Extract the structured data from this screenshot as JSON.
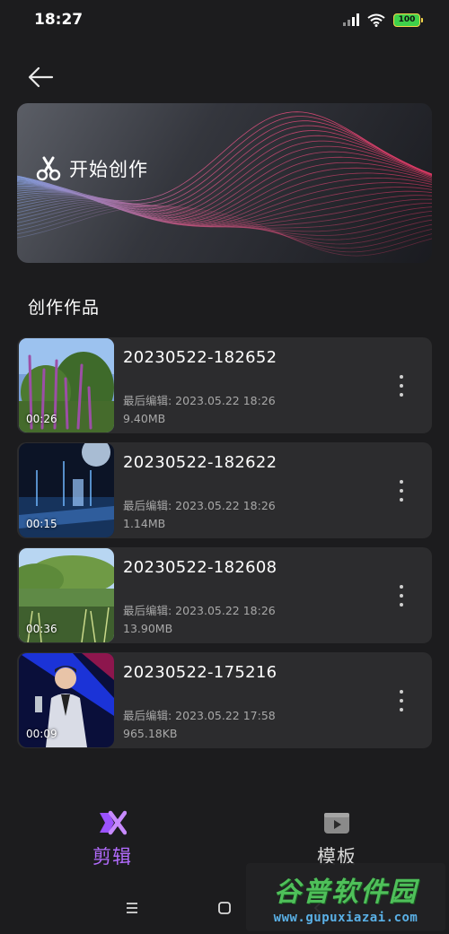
{
  "status_bar": {
    "time": "18:27",
    "battery": "100",
    "battery_color": "#3fd14a"
  },
  "header": {
    "back_icon": "arrow-left-icon"
  },
  "banner": {
    "title": "开始创作",
    "icon": "scissors-icon"
  },
  "section": {
    "title": "创作作品"
  },
  "works": [
    {
      "title": "20230522-182652",
      "edited": "最后编辑: 2023.05.22 18:26",
      "size": "9.40MB",
      "duration": "00:26"
    },
    {
      "title": "20230522-182622",
      "edited": "最后编辑: 2023.05.22 18:26",
      "size": "1.14MB",
      "duration": "00:15"
    },
    {
      "title": "20230522-182608",
      "edited": "最后编辑: 2023.05.22 18:26",
      "size": "13.90MB",
      "duration": "00:36"
    },
    {
      "title": "20230522-175216",
      "edited": "最后编辑: 2023.05.22 17:58",
      "size": "965.18KB",
      "duration": "00:09"
    }
  ],
  "tabs": [
    {
      "label": "剪辑",
      "icon": "edit-logo-icon",
      "active": true,
      "color": "#b36cff"
    },
    {
      "label": "模板",
      "icon": "template-play-icon",
      "active": false,
      "color": "#d7d7d7"
    }
  ],
  "nav": {
    "menu_icon": "menu-icon",
    "home_icon": "home-icon",
    "back_icon": "back-icon"
  },
  "watermark": {
    "name": "谷普软件园",
    "url": "www.gupuxiazai.com"
  }
}
